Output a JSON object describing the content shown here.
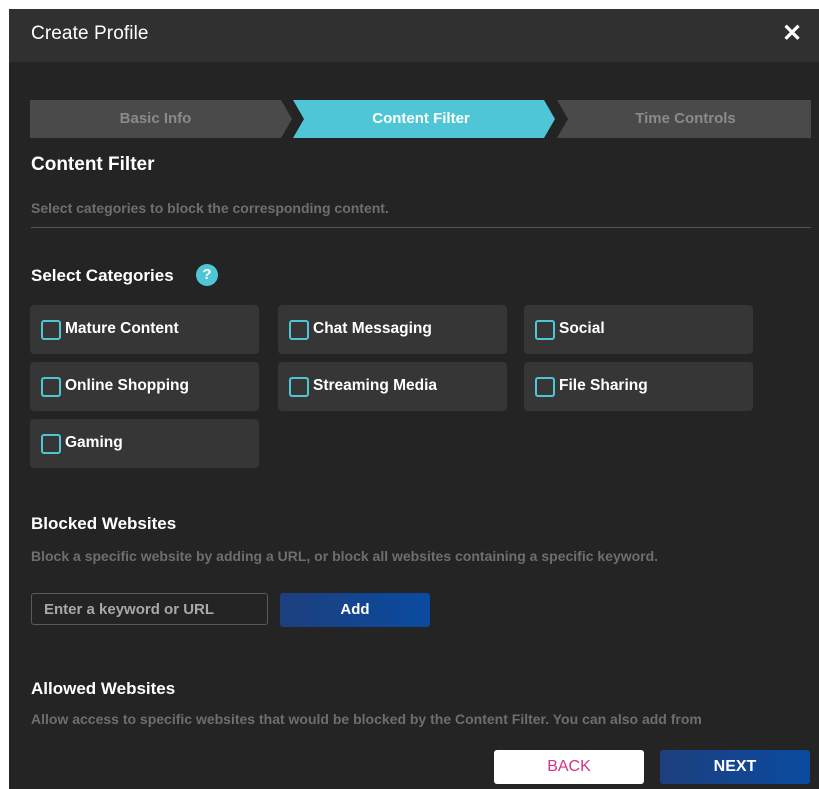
{
  "dialog": {
    "title": "Create Profile",
    "close_icon": "close-icon"
  },
  "stepper": {
    "steps": [
      {
        "label": "Basic Info",
        "active": false
      },
      {
        "label": "Content Filter",
        "active": true
      },
      {
        "label": "Time Controls",
        "active": false
      }
    ],
    "active_color": "#4fc6d6",
    "inactive_color": "#4a4a4a"
  },
  "content_filter": {
    "heading": "Content Filter",
    "description": "Select categories to block the corresponding content.",
    "select_heading": "Select Categories",
    "help_icon": "question-icon",
    "help_glyph": "?",
    "categories": [
      {
        "label": "Mature Content",
        "checked": false
      },
      {
        "label": "Chat Messaging",
        "checked": false
      },
      {
        "label": "Social",
        "checked": false
      },
      {
        "label": "Online Shopping",
        "checked": false
      },
      {
        "label": "Streaming Media",
        "checked": false
      },
      {
        "label": "File Sharing",
        "checked": false
      },
      {
        "label": "Gaming",
        "checked": false
      }
    ]
  },
  "blocked": {
    "heading": "Blocked Websites",
    "description": "Block a specific website by adding a URL, or block all websites containing a specific keyword.",
    "input_placeholder": "Enter a keyword or URL",
    "input_value": "",
    "add_label": "Add"
  },
  "allowed": {
    "heading": "Allowed Websites",
    "description": "Allow access to specific websites that would be blocked by the Content Filter. You can also add from"
  },
  "footer": {
    "back_label": "BACK",
    "next_label": "NEXT"
  },
  "colors": {
    "accent": "#4fc6d6",
    "primary_button": "#0a4ba0",
    "back_text": "#d63384"
  }
}
